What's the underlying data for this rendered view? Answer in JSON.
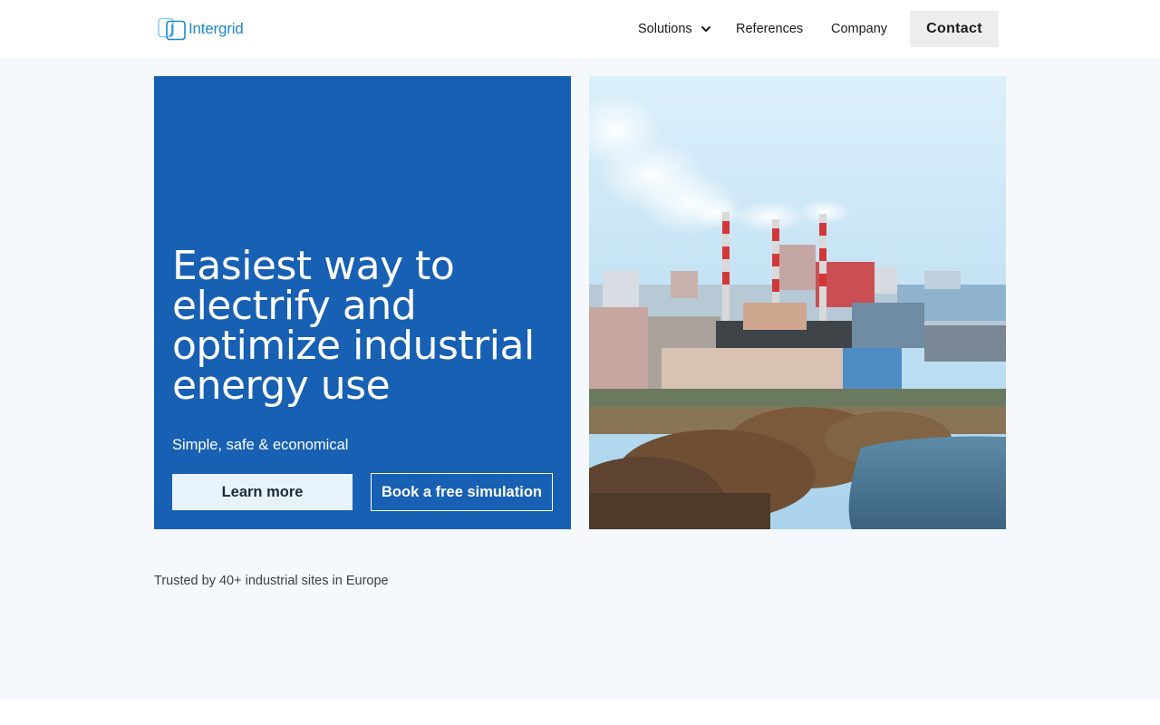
{
  "brand": {
    "name": "Intergrid",
    "color": "#1e88c9"
  },
  "nav": {
    "solutions": "Solutions",
    "references": "References",
    "company": "Company",
    "contact": "Contact"
  },
  "hero": {
    "title": "Easiest way to electrify and optimize industrial energy use",
    "subtitle": "Simple, safe & economical",
    "primary_cta": "Learn more",
    "secondary_cta": "Book a free simulation",
    "card_color": "#1760b3"
  },
  "trusted": "Trusted by 40+ industrial sites in Europe",
  "icons": [
    "intergrid-logo-icon",
    "chevron-down-icon"
  ]
}
